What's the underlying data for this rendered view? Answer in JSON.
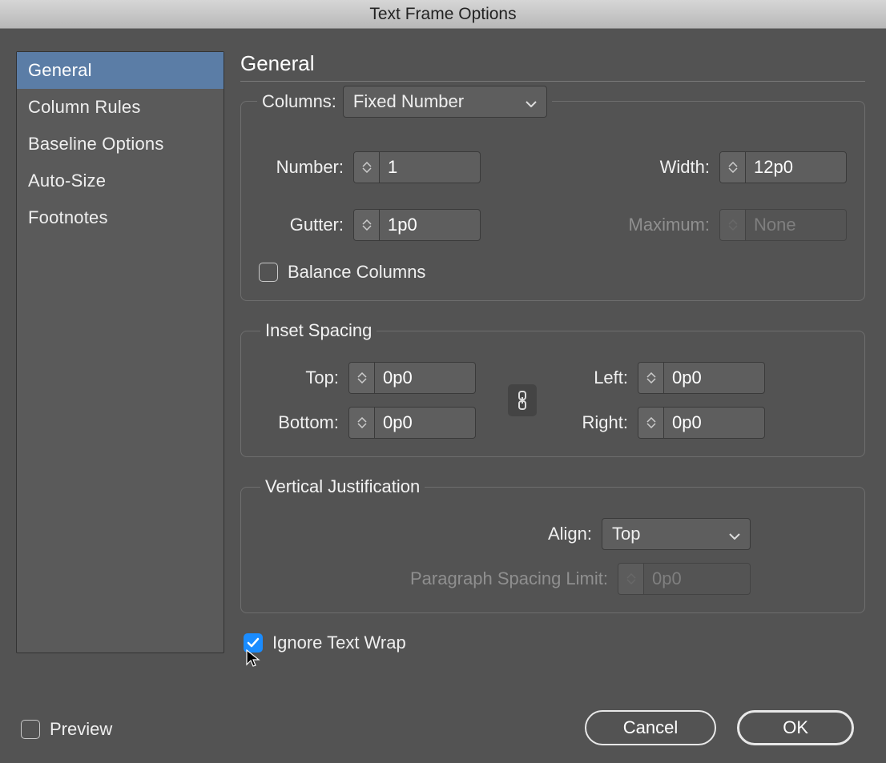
{
  "window": {
    "title": "Text Frame Options"
  },
  "sidebar": {
    "items": [
      {
        "label": "General",
        "active": true
      },
      {
        "label": "Column Rules",
        "active": false
      },
      {
        "label": "Baseline Options",
        "active": false
      },
      {
        "label": "Auto-Size",
        "active": false
      },
      {
        "label": "Footnotes",
        "active": false
      }
    ]
  },
  "main": {
    "heading": "General",
    "columns": {
      "legend_label": "Columns:",
      "mode": "Fixed Number",
      "number_label": "Number:",
      "number_value": "1",
      "gutter_label": "Gutter:",
      "gutter_value": "1p0",
      "width_label": "Width:",
      "width_value": "12p0",
      "max_label": "Maximum:",
      "max_value": "None",
      "balance_label": "Balance Columns",
      "balance_checked": false
    },
    "inset": {
      "legend": "Inset Spacing",
      "top_label": "Top:",
      "top_value": "0p0",
      "bottom_label": "Bottom:",
      "bottom_value": "0p0",
      "left_label": "Left:",
      "left_value": "0p0",
      "right_label": "Right:",
      "right_value": "0p0",
      "linked": true
    },
    "vjust": {
      "legend": "Vertical Justification",
      "align_label": "Align:",
      "align_value": "Top",
      "psl_label": "Paragraph Spacing Limit:",
      "psl_value": "0p0"
    },
    "ignore_wrap": {
      "label": "Ignore Text Wrap",
      "checked": true
    }
  },
  "footer": {
    "preview_label": "Preview",
    "preview_checked": false,
    "cancel": "Cancel",
    "ok": "OK"
  }
}
